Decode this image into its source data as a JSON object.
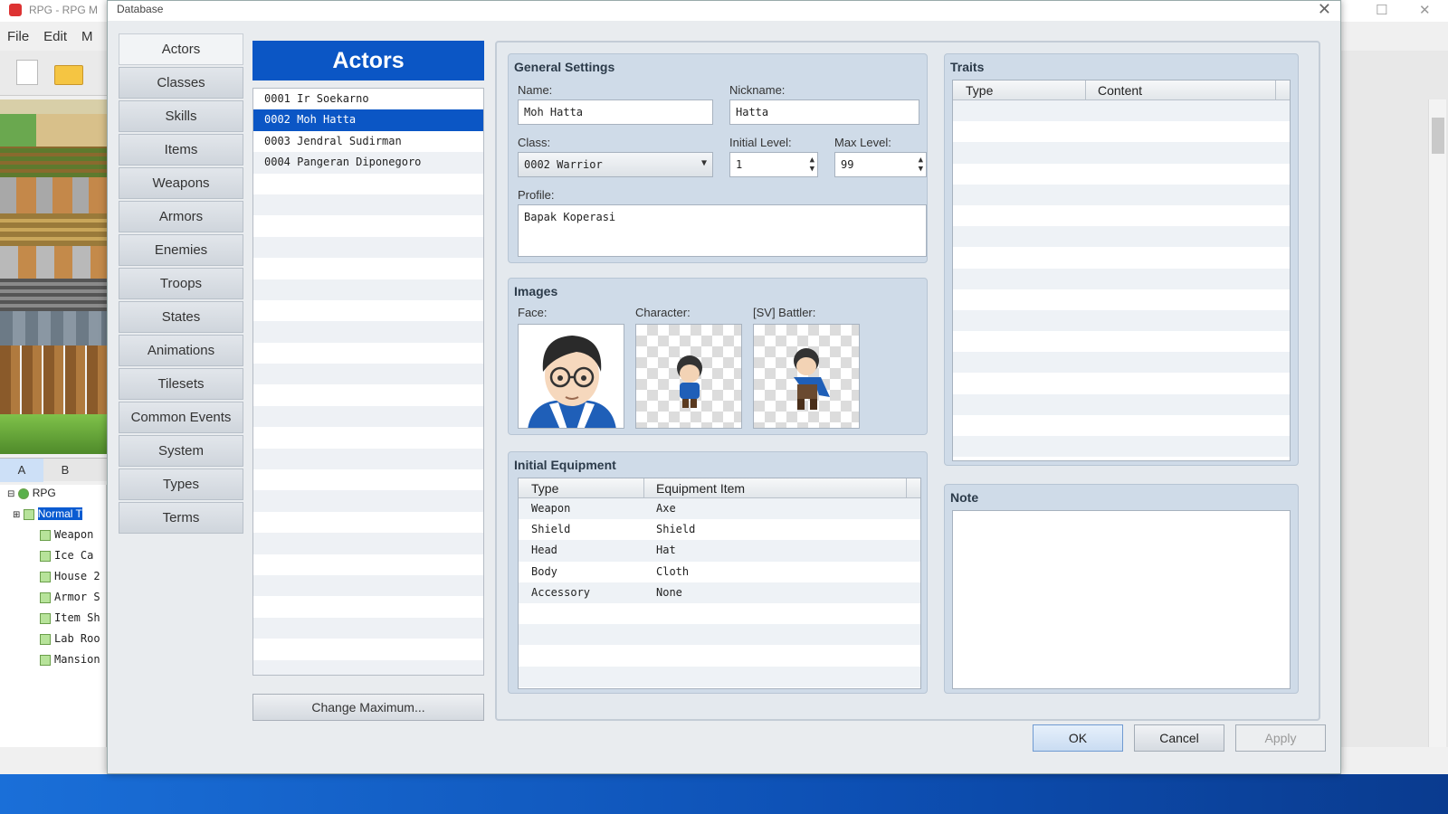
{
  "background_window": {
    "title": "RPG - RPG M",
    "menu": [
      "File",
      "Edit",
      "M"
    ],
    "tileset_tabs": [
      "A",
      "B"
    ],
    "map_tree": [
      {
        "label": "RPG",
        "selected": false,
        "indent": 0
      },
      {
        "label": "Normal T",
        "selected": true,
        "indent": 1
      },
      {
        "label": "Weapon",
        "selected": false,
        "indent": 2
      },
      {
        "label": "Ice Ca",
        "selected": false,
        "indent": 2
      },
      {
        "label": "House 2",
        "selected": false,
        "indent": 2
      },
      {
        "label": "Armor S",
        "selected": false,
        "indent": 2
      },
      {
        "label": "Item Sh",
        "selected": false,
        "indent": 2
      },
      {
        "label": "Lab Roo",
        "selected": false,
        "indent": 2
      },
      {
        "label": "Mansion",
        "selected": false,
        "indent": 2
      }
    ]
  },
  "dialog": {
    "title": "Database",
    "close_glyph": "✕",
    "categories": [
      "Actors",
      "Classes",
      "Skills",
      "Items",
      "Weapons",
      "Armors",
      "Enemies",
      "Troops",
      "States",
      "Animations",
      "Tilesets",
      "Common Events",
      "System",
      "Types",
      "Terms"
    ],
    "active_category": "Actors",
    "list_header": "Actors",
    "actors": [
      {
        "label": "0001 Ir Soekarno",
        "selected": false
      },
      {
        "label": "0002 Moh Hatta",
        "selected": true
      },
      {
        "label": "0003 Jendral Sudirman",
        "selected": false
      },
      {
        "label": "0004 Pangeran Diponegoro",
        "selected": false
      }
    ],
    "change_max_label": "Change Maximum...",
    "general": {
      "title": "General Settings",
      "name_label": "Name:",
      "name_value": "Moh Hatta",
      "nickname_label": "Nickname:",
      "nickname_value": "Hatta",
      "class_label": "Class:",
      "class_value": "0002 Warrior",
      "initial_level_label": "Initial Level:",
      "initial_level_value": "1",
      "max_level_label": "Max Level:",
      "max_level_value": "99",
      "profile_label": "Profile:",
      "profile_value": "Bapak Koperasi"
    },
    "images": {
      "title": "Images",
      "face_label": "Face:",
      "character_label": "Character:",
      "battler_label": "[SV] Battler:"
    },
    "equipment": {
      "title": "Initial Equipment",
      "columns": [
        "Type",
        "Equipment Item"
      ],
      "rows": [
        {
          "type": "Weapon",
          "item": "Axe"
        },
        {
          "type": "Shield",
          "item": "Shield"
        },
        {
          "type": "Head",
          "item": "Hat"
        },
        {
          "type": "Body",
          "item": "Cloth"
        },
        {
          "type": "Accessory",
          "item": "None"
        }
      ]
    },
    "traits": {
      "title": "Traits",
      "columns": [
        "Type",
        "Content"
      ]
    },
    "note": {
      "title": "Note"
    },
    "buttons": {
      "ok": "OK",
      "cancel": "Cancel",
      "apply": "Apply"
    }
  },
  "colors": {
    "accent": "#0b56c5",
    "group_bg": "#cfdbe8",
    "taskbar": "#1a6fd8"
  }
}
